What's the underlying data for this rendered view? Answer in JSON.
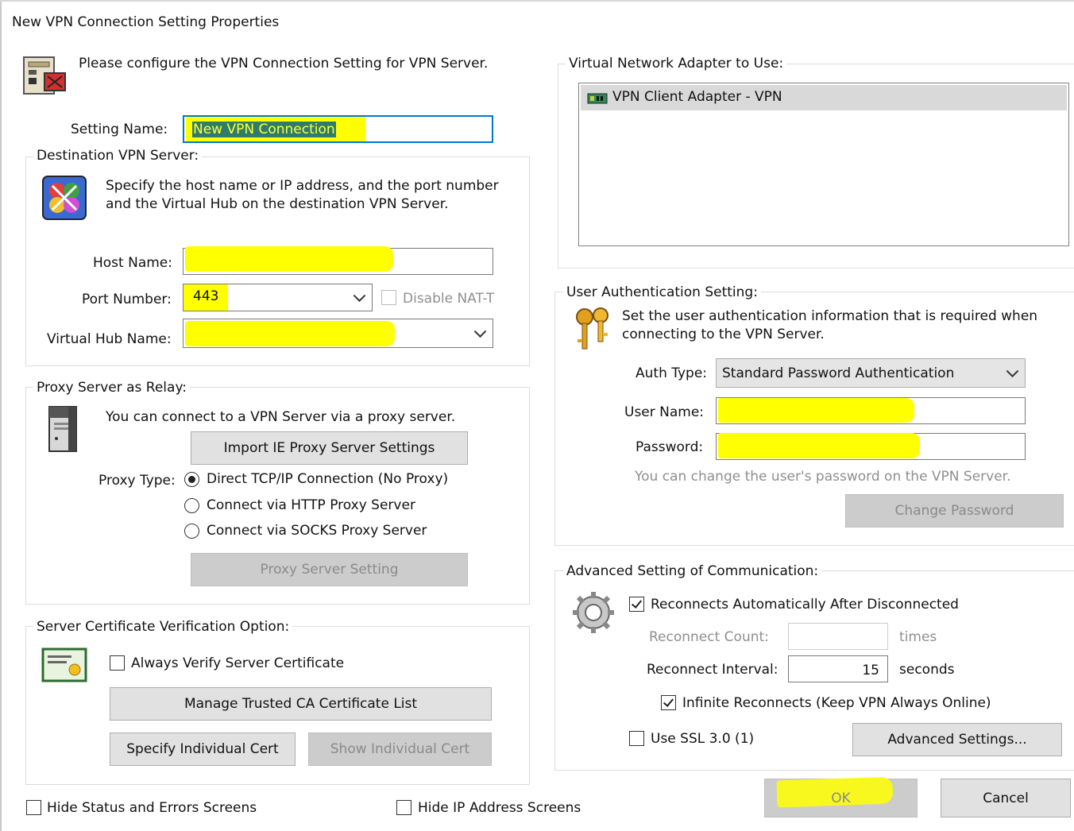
{
  "window": {
    "title": "New VPN Connection Setting Properties"
  },
  "intro": {
    "text": "Please configure the VPN Connection Setting for VPN Server."
  },
  "setting_name": {
    "label": "Setting Name:",
    "value": "New VPN Connection"
  },
  "destination": {
    "group_title": "Destination VPN Server:",
    "description_line1": "Specify the host name or IP address, and the port number",
    "description_line2": "and the Virtual Hub on the destination VPN Server.",
    "host_label": "Host Name:",
    "host_value": "",
    "port_label": "Port Number:",
    "port_value": "443",
    "disable_natt_label": "Disable NAT-T",
    "hub_label": "Virtual Hub Name:",
    "hub_value": ""
  },
  "proxy": {
    "group_title": "Proxy Server as Relay:",
    "description": "You can connect to a VPN Server via a proxy server.",
    "import_button": "Import IE Proxy Server Settings",
    "type_label": "Proxy Type:",
    "options": [
      {
        "label": "Direct TCP/IP Connection (No Proxy)",
        "selected": true
      },
      {
        "label": "Connect via HTTP Proxy Server",
        "selected": false
      },
      {
        "label": "Connect via SOCKS Proxy Server",
        "selected": false
      }
    ],
    "setting_button": "Proxy Server Setting"
  },
  "cert": {
    "group_title": "Server Certificate Verification Option:",
    "always_verify_label": "Always Verify Server Certificate",
    "manage_button": "Manage Trusted CA Certificate List",
    "specify_button": "Specify Individual Cert",
    "show_button": "Show Individual Cert"
  },
  "bottom": {
    "hide_status_label": "Hide Status and Errors Screens",
    "hide_ip_label": "Hide IP Address Screens",
    "ok_button": "OK",
    "cancel_button": "Cancel"
  },
  "adapter": {
    "group_title": "Virtual Network Adapter to Use:",
    "items": [
      "VPN Client Adapter - VPN"
    ]
  },
  "auth": {
    "group_title": "User Authentication Setting:",
    "description_line1": "Set the user authentication information that is required when",
    "description_line2": "connecting to the VPN Server.",
    "type_label": "Auth Type:",
    "type_value": "Standard Password Authentication",
    "user_label": "User Name:",
    "user_value": "",
    "password_label": "Password:",
    "password_value": "",
    "note": "You can change the user's password on the VPN Server.",
    "change_button": "Change Password"
  },
  "advanced": {
    "group_title": "Advanced Setting of Communication:",
    "reconnect_label": "Reconnects Automatically After Disconnected",
    "count_label": "Reconnect Count:",
    "count_value": "",
    "count_unit": "times",
    "interval_label": "Reconnect Interval:",
    "interval_value": "15",
    "interval_unit": "seconds",
    "infinite_label": "Infinite Reconnects (Keep VPN Always Online)",
    "ssl_label": "Use SSL 3.0 (1)",
    "advanced_button": "Advanced Settings..."
  },
  "colors": {
    "highlight": "#ffff00",
    "focus_border": "#0078d7",
    "selection": "#cce4f7"
  }
}
